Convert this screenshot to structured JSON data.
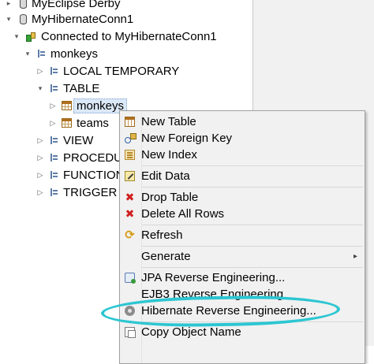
{
  "tree": {
    "rows": [
      {
        "label": "MyEclipse Derby",
        "icon": "database-icon"
      },
      {
        "label": "MyHibernateConn1",
        "icon": "database-icon"
      },
      {
        "label": "Connected to MyHibernateConn1",
        "icon": "connection-icon"
      },
      {
        "label": "monkeys",
        "icon": "schema-icon"
      },
      {
        "label": "LOCAL TEMPORARY",
        "icon": "folder-icon"
      },
      {
        "label": "TABLE",
        "icon": "folder-icon"
      },
      {
        "label": "monkeys",
        "icon": "table-icon",
        "selected": true
      },
      {
        "label": "teams",
        "icon": "table-icon"
      },
      {
        "label": "VIEW",
        "icon": "folder-icon"
      },
      {
        "label": "PROCEDU",
        "icon": "folder-icon"
      },
      {
        "label": "FUNCTION",
        "icon": "folder-icon"
      },
      {
        "label": "TRIGGER",
        "icon": "folder-icon"
      }
    ]
  },
  "context_menu": {
    "items": [
      {
        "label": "New Table",
        "icon": "new-table-icon"
      },
      {
        "label": "New Foreign Key",
        "icon": "foreign-key-icon"
      },
      {
        "label": "New Index",
        "icon": "index-icon"
      },
      {
        "label": "Edit Data",
        "icon": "edit-data-icon"
      },
      {
        "label": "Drop Table",
        "icon": "drop-icon"
      },
      {
        "label": "Delete All Rows",
        "icon": "delete-icon"
      },
      {
        "label": "Refresh",
        "icon": "refresh-icon"
      },
      {
        "label": "Generate",
        "icon": "",
        "submenu": true
      },
      {
        "label": "JPA Reverse Engineering...",
        "icon": "jpa-icon"
      },
      {
        "label": "EJB3 Reverse Engineering",
        "icon": ""
      },
      {
        "label": "Hibernate Reverse Engineering...",
        "icon": "hibernate-icon",
        "annotated": true
      },
      {
        "label": "Copy Object Name",
        "icon": "copy-icon"
      }
    ],
    "submenu_arrow": "▸"
  },
  "colors": {
    "highlight_annotation": "#2cc6d2",
    "selection": "#dbe8f7",
    "menu_background": "#f1f1f1"
  }
}
